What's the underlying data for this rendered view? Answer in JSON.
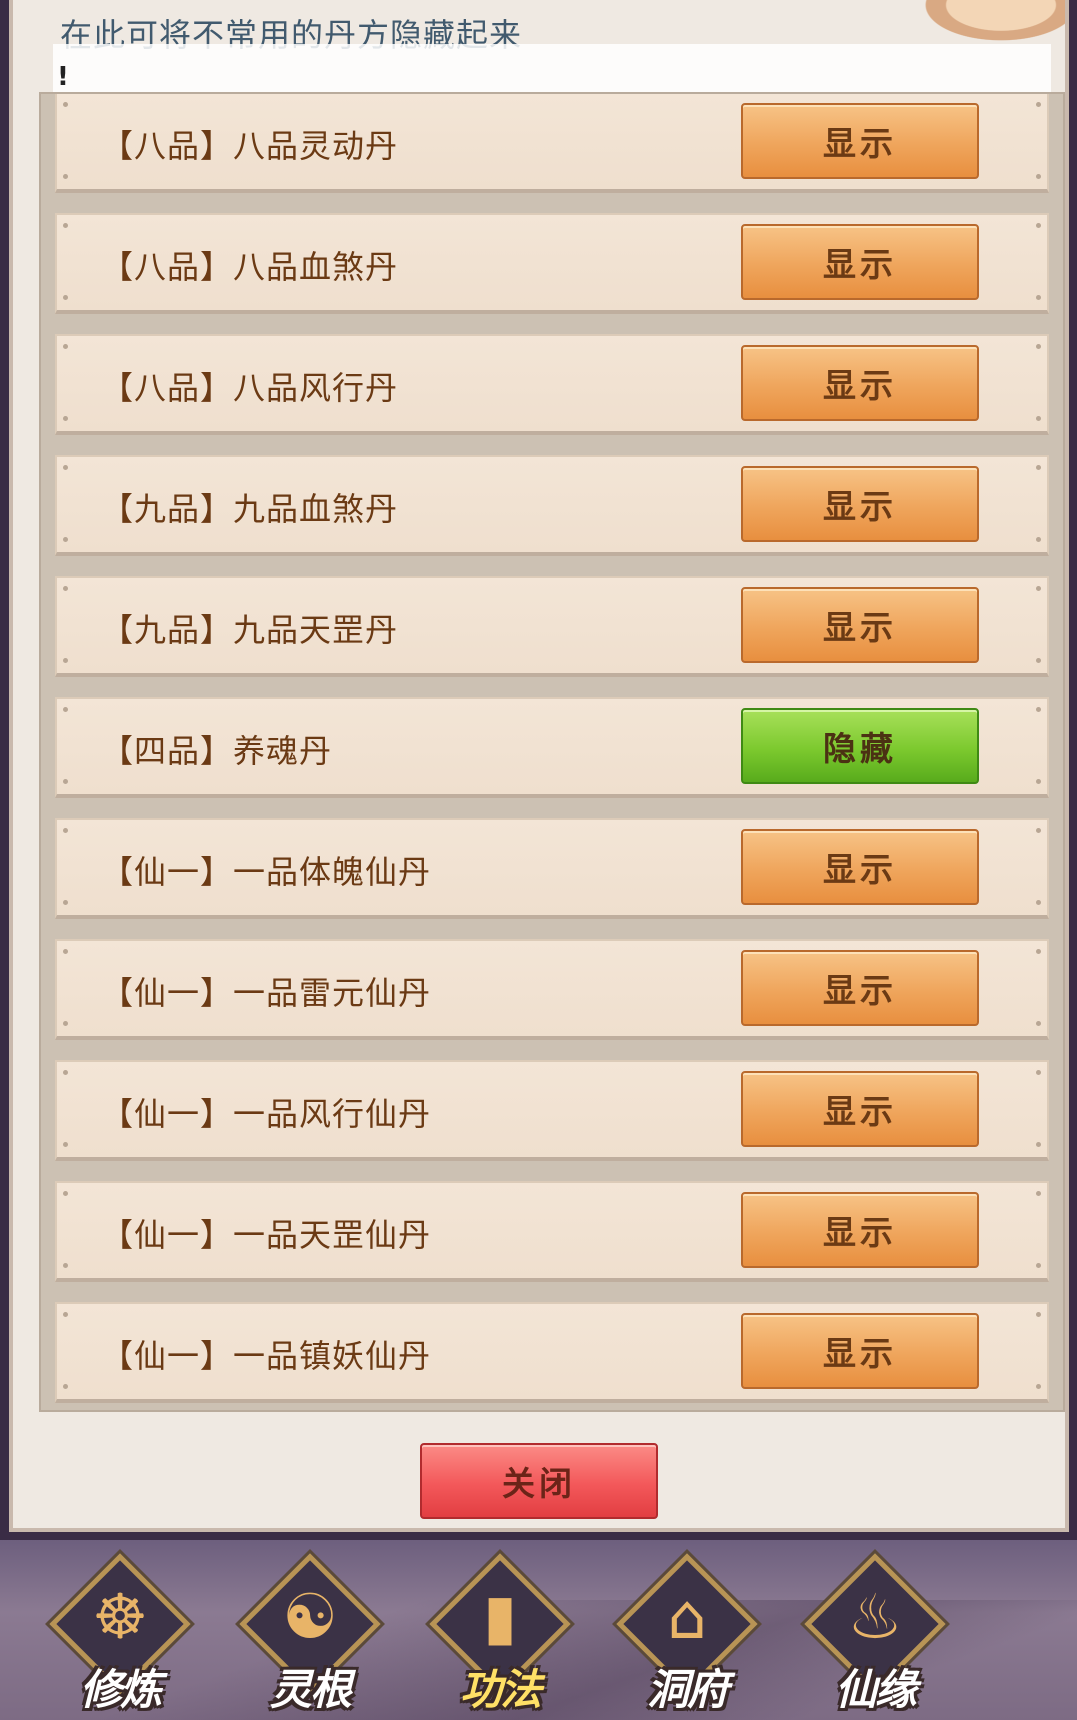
{
  "dialog": {
    "title": "在此可将不常用的丹方隐藏起来",
    "notice": "!",
    "close_label": "关闭"
  },
  "recipes": [
    {
      "label": "【八品】八品灵动丹",
      "action": "显示",
      "state": "show"
    },
    {
      "label": "【八品】八品血煞丹",
      "action": "显示",
      "state": "show"
    },
    {
      "label": "【八品】八品风行丹",
      "action": "显示",
      "state": "show"
    },
    {
      "label": "【九品】九品血煞丹",
      "action": "显示",
      "state": "show"
    },
    {
      "label": "【九品】九品天罡丹",
      "action": "显示",
      "state": "show"
    },
    {
      "label": "【四品】养魂丹",
      "action": "隐藏",
      "state": "hide"
    },
    {
      "label": "【仙一】一品体魄仙丹",
      "action": "显示",
      "state": "show"
    },
    {
      "label": "【仙一】一品雷元仙丹",
      "action": "显示",
      "state": "show"
    },
    {
      "label": "【仙一】一品风行仙丹",
      "action": "显示",
      "state": "show"
    },
    {
      "label": "【仙一】一品天罡仙丹",
      "action": "显示",
      "state": "show"
    },
    {
      "label": "【仙一】一品镇妖仙丹",
      "action": "显示",
      "state": "show"
    }
  ],
  "nav": [
    {
      "label": "修炼",
      "icon": "monk-icon",
      "active": false
    },
    {
      "label": "灵根",
      "icon": "sword-yin-yang-icon",
      "active": false
    },
    {
      "label": "功法",
      "icon": "book-icon",
      "active": true
    },
    {
      "label": "洞府",
      "icon": "pavilion-icon",
      "active": false
    },
    {
      "label": "仙缘",
      "icon": "gourd-icon",
      "active": false
    }
  ],
  "colors": {
    "show_button": "#efa55c",
    "hide_button": "#7cc92e",
    "close_button": "#f3585a",
    "row_text": "#6b3a14",
    "title_text": "#415a6e"
  }
}
